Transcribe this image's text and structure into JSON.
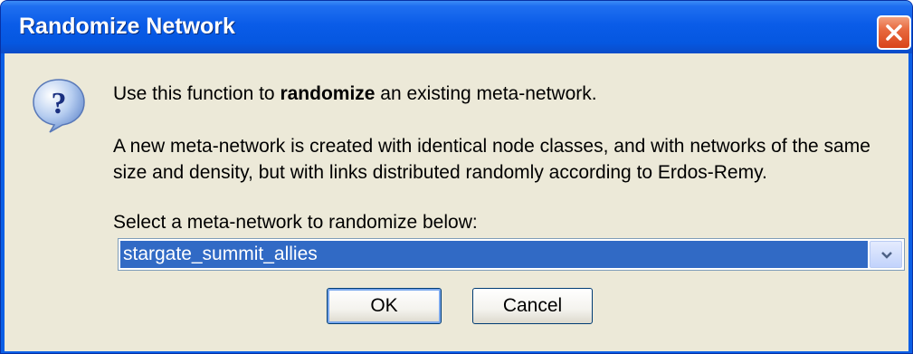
{
  "window": {
    "title": "Randomize Network"
  },
  "icons": {
    "dialog": "question-icon",
    "close": "close-icon",
    "dropdown": "chevron-down-icon"
  },
  "message": {
    "line1_before": "Use this function to ",
    "line1_bold": "randomize",
    "line1_after": " an existing meta-network.",
    "line2": "A new meta-network is created with identical node classes, and with networks of the same",
    "line3": "size and density, but with links distributed randomly according to Erdos-Remy.",
    "prompt": "Select a meta-network to randomize below:"
  },
  "select": {
    "value": "stargate_summit_allies"
  },
  "buttons": {
    "ok": "OK",
    "cancel": "Cancel"
  },
  "colors": {
    "titlebar": "#0a5ce8",
    "client": "#ece9d8",
    "selection": "#316ac5",
    "close": "#e86a3f"
  }
}
